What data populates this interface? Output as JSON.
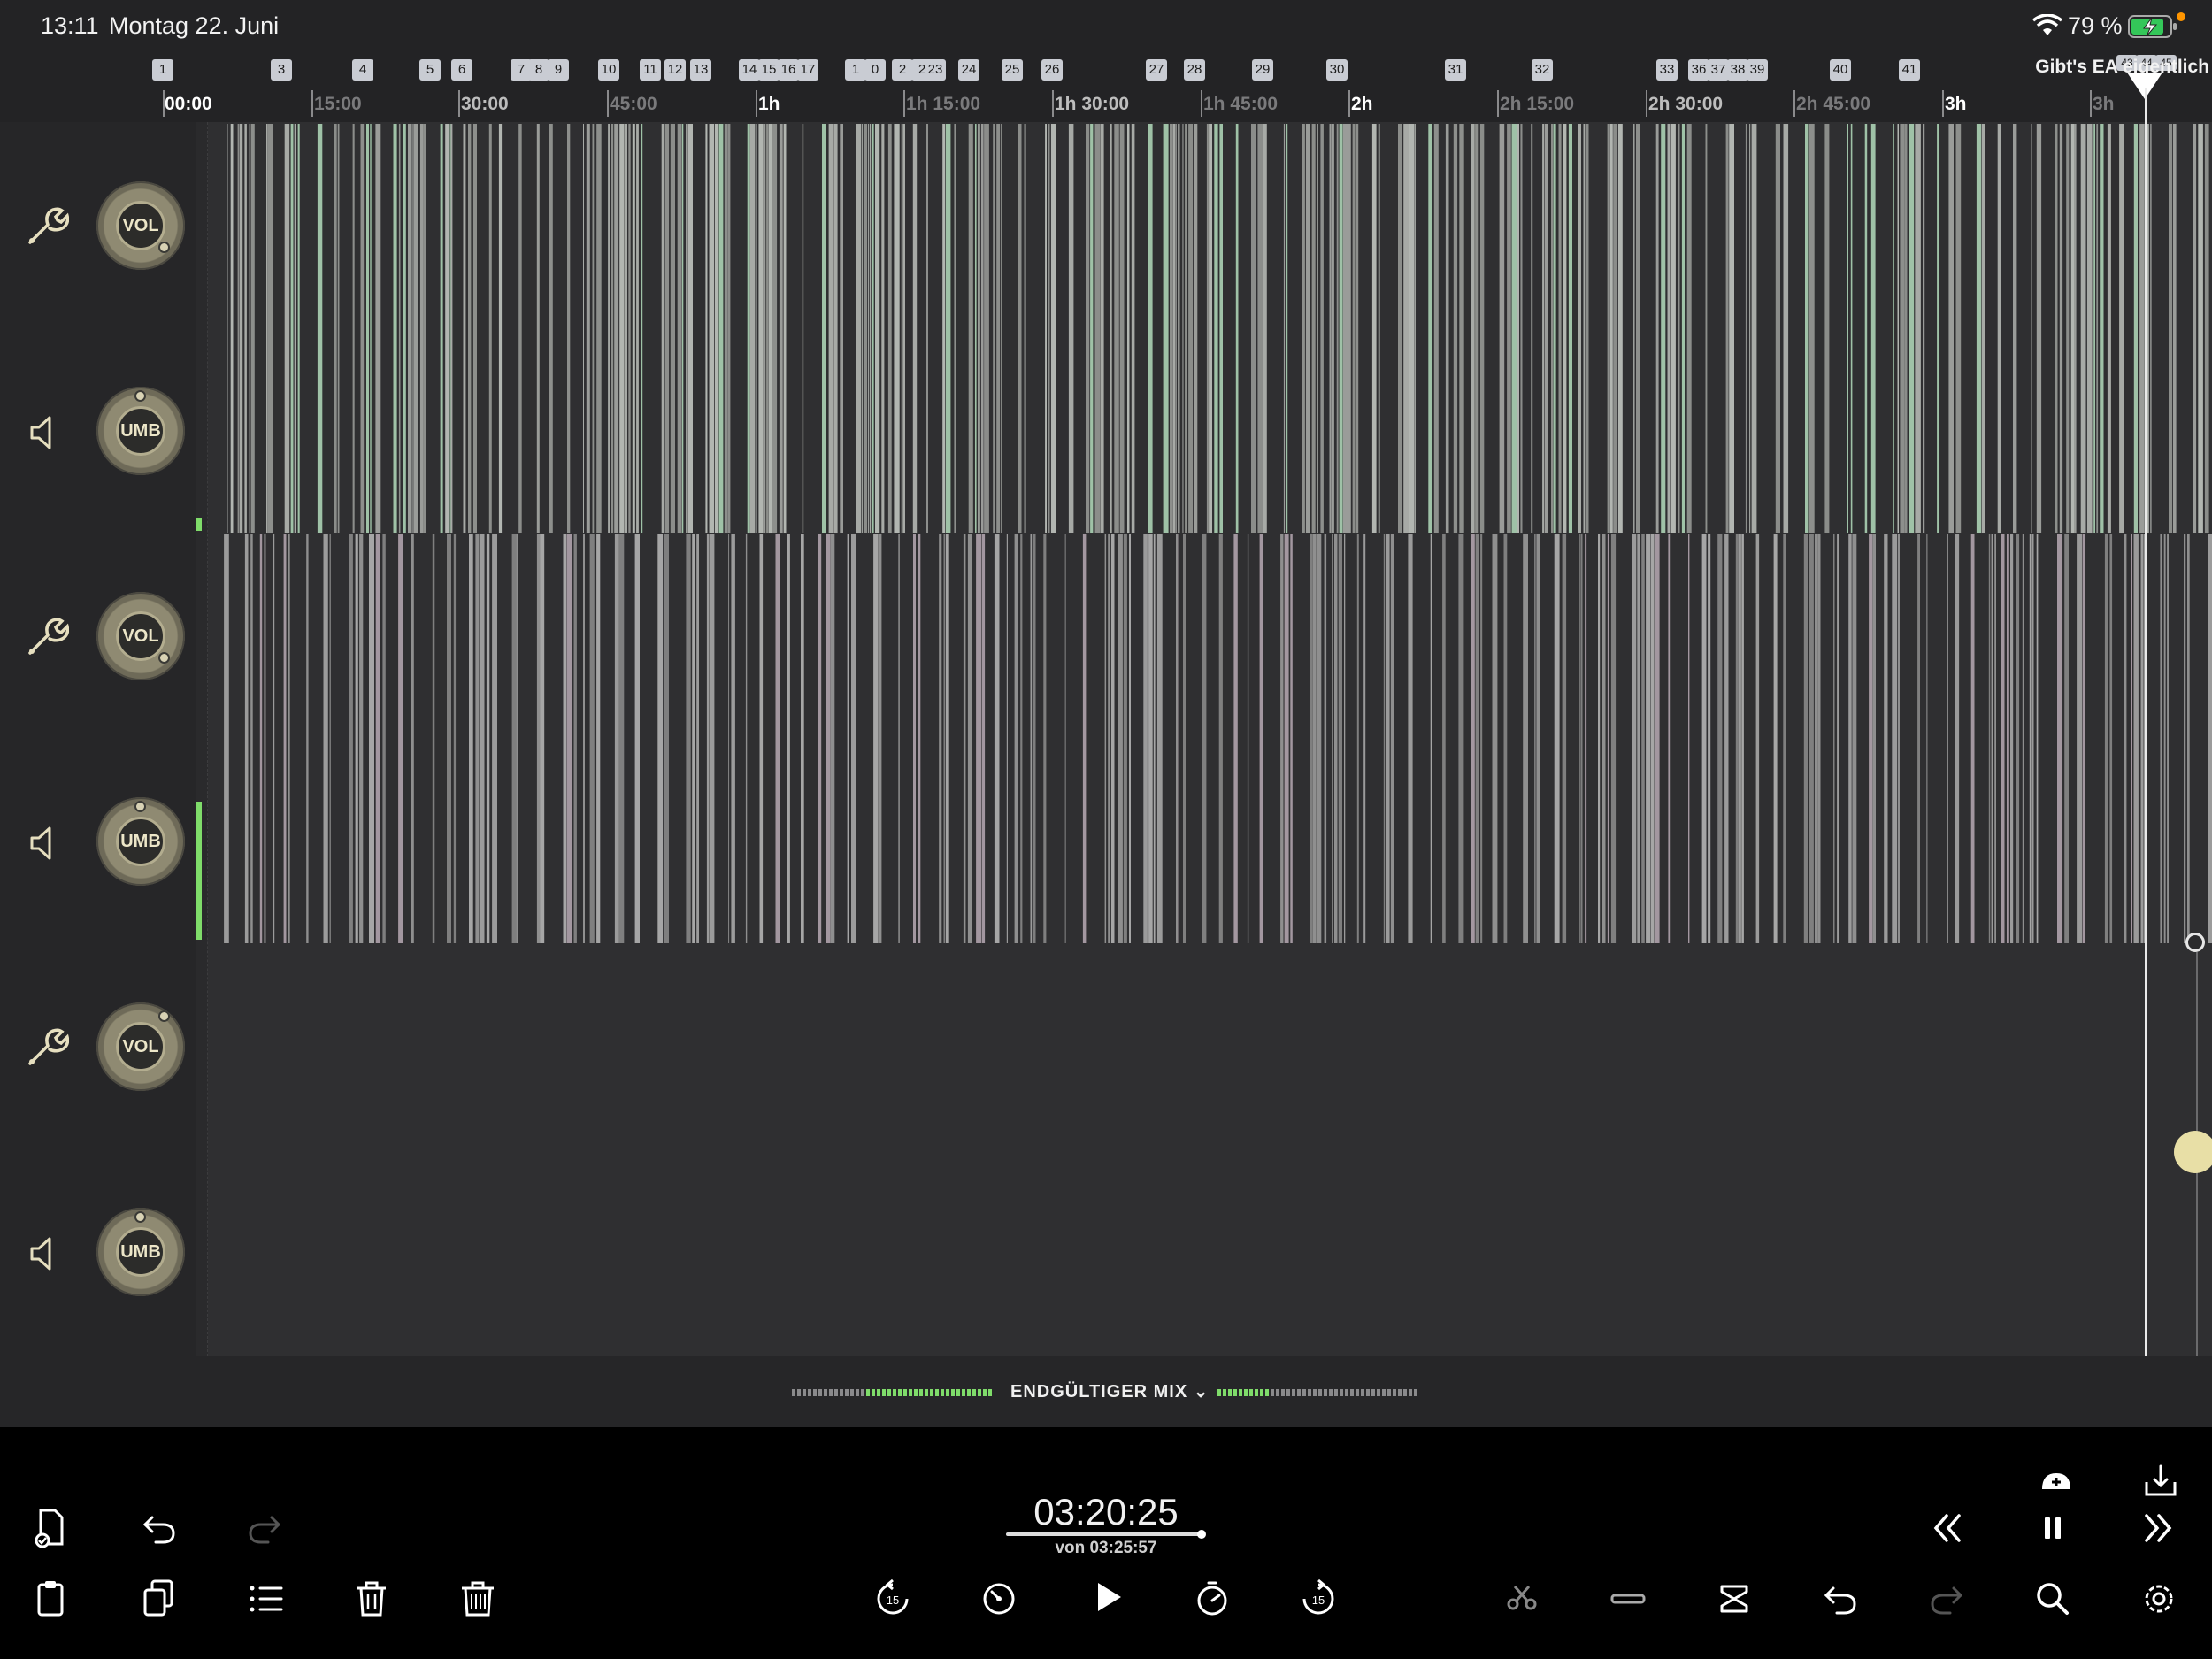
{
  "status_bar": {
    "time": "13:11",
    "date": "Montag 22. Juni",
    "battery_percent": "79 %",
    "wifi_icon": "wifi-icon",
    "battery_icon": "battery-charging-icon"
  },
  "chapters": {
    "markers": [
      "1",
      "3",
      "4",
      "5",
      "6",
      "7",
      "8",
      "9",
      "10",
      "11",
      "12",
      "13",
      "14",
      "15",
      "16",
      "17",
      "1",
      "0",
      "2",
      "2",
      "23",
      "24",
      "25",
      "26",
      "27",
      "28",
      "29",
      "30",
      "31",
      "32",
      "33",
      "36",
      "37",
      "38",
      "39",
      "40",
      "41",
      "43",
      "44",
      "45"
    ],
    "current_title": "Gibt's EA eigentlich"
  },
  "ruler": {
    "labels": [
      "00:00",
      "15:00",
      "30:00",
      "45:00",
      "1h",
      "1h 15:00",
      "1h 30:00",
      "1h 45:00",
      "2h",
      "2h 15:00",
      "2h 30:00",
      "2h 45:00",
      "3h",
      "3h"
    ]
  },
  "tracks": [
    {
      "knob_top": "VOL",
      "knob_bottom": "UMB",
      "level": 0.55,
      "color": "#aeb2ad"
    },
    {
      "knob_top": "VOL",
      "knob_bottom": "UMB",
      "level": 0.55,
      "color": "#9a9a9a"
    },
    {
      "knob_top": "VOL",
      "knob_bottom": "UMB",
      "level": 0.55,
      "color": "#9a9a9a"
    }
  ],
  "mix": {
    "label": "ENDGÜLTIGER MIX"
  },
  "transport": {
    "position": "03:20:25",
    "duration": "von 03:25:57",
    "progress": 0.974
  },
  "colors": {
    "accent": "#e8dfa6",
    "meter_green": "#7fdc6a",
    "waveform_light": "#b9bdb8",
    "waveform_green": "#9fc7a8"
  },
  "icons": {
    "top_left": [
      "file-check-icon",
      "undo-icon",
      "redo-icon"
    ],
    "bottom_left": [
      "paste-icon",
      "copy-icon",
      "chapter-list-icon",
      "delete-icon",
      "delete-all-icon"
    ],
    "center": [
      "skip-back-15-icon",
      "speed-icon",
      "play-icon",
      "timer-icon",
      "skip-forward-15-icon"
    ],
    "right_top": [
      "add-marker-icon",
      "export-icon"
    ],
    "right_mid": [
      "rewind-icon",
      "pause-icon",
      "fast-forward-icon"
    ],
    "right_bottom": [
      "cut-icon",
      "trim-icon",
      "split-icon",
      "undo-icon",
      "redo-icon",
      "search-icon",
      "settings-icon"
    ]
  }
}
